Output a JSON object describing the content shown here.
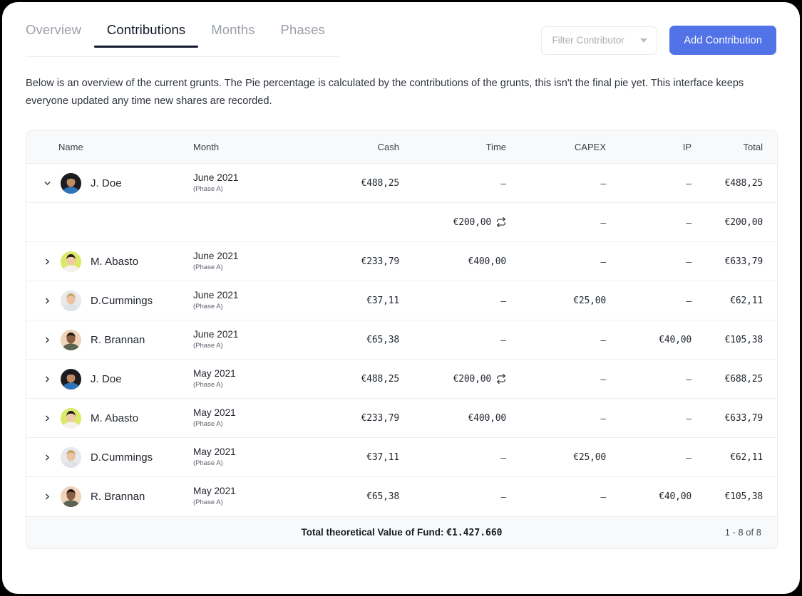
{
  "tabs": [
    {
      "label": "Overview",
      "active": false
    },
    {
      "label": "Contributions",
      "active": true
    },
    {
      "label": "Months",
      "active": false
    },
    {
      "label": "Phases",
      "active": false
    }
  ],
  "toolbar": {
    "filter_placeholder": "Filter Contributor",
    "add_button_label": "Add Contribution"
  },
  "description": "Below is an overview of the current grunts. The Pie percentage is calculated by the contributions of the grunts, this isn't the final pie yet. This interface keeps everyone updated any time new shares are recorded.",
  "table": {
    "columns": [
      "Name",
      "Month",
      "Cash",
      "Time",
      "CAPEX",
      "IP",
      "Total"
    ],
    "rows": [
      {
        "expanded": true,
        "sub": false,
        "name": "J. Doe",
        "avatar": "avatar-jdoe",
        "month": "June 2021",
        "phase": "(Phase A)",
        "cash": "€488,25",
        "time": "–",
        "time_recurring": false,
        "capex": "–",
        "ip": "–",
        "total": "€488,25"
      },
      {
        "expanded": false,
        "sub": true,
        "name": "",
        "avatar": "",
        "month": "",
        "phase": "",
        "cash": "",
        "time": "€200,00",
        "time_recurring": true,
        "capex": "–",
        "ip": "–",
        "total": "€200,00"
      },
      {
        "expanded": false,
        "sub": false,
        "name": "M. Abasto",
        "avatar": "avatar-mabasto",
        "month": "June 2021",
        "phase": "(Phase A)",
        "cash": "€233,79",
        "time": "€400,00",
        "time_recurring": false,
        "capex": "–",
        "ip": "–",
        "total": "€633,79"
      },
      {
        "expanded": false,
        "sub": false,
        "name": "D.Cummings",
        "avatar": "avatar-dcummings",
        "month": "June 2021",
        "phase": "(Phase A)",
        "cash": "€37,11",
        "time": "–",
        "time_recurring": false,
        "capex": "€25,00",
        "ip": "–",
        "total": "€62,11"
      },
      {
        "expanded": false,
        "sub": false,
        "name": "R. Brannan",
        "avatar": "avatar-rbrannan",
        "month": "June 2021",
        "phase": "(Phase A)",
        "cash": "€65,38",
        "time": "–",
        "time_recurring": false,
        "capex": "–",
        "ip": "€40,00",
        "total": "€105,38"
      },
      {
        "expanded": false,
        "sub": false,
        "name": "J. Doe",
        "avatar": "avatar-jdoe",
        "month": "May 2021",
        "phase": "(Phase A)",
        "cash": "€488,25",
        "time": "€200,00",
        "time_recurring": true,
        "capex": "–",
        "ip": "–",
        "total": "€688,25"
      },
      {
        "expanded": false,
        "sub": false,
        "name": "M. Abasto",
        "avatar": "avatar-mabasto",
        "month": "May 2021",
        "phase": "(Phase A)",
        "cash": "€233,79",
        "time": "€400,00",
        "time_recurring": false,
        "capex": "–",
        "ip": "–",
        "total": "€633,79"
      },
      {
        "expanded": false,
        "sub": false,
        "name": "D.Cummings",
        "avatar": "avatar-dcummings",
        "month": "May 2021",
        "phase": "(Phase A)",
        "cash": "€37,11",
        "time": "–",
        "time_recurring": false,
        "capex": "€25,00",
        "ip": "–",
        "total": "€62,11"
      },
      {
        "expanded": false,
        "sub": false,
        "name": "R. Brannan",
        "avatar": "avatar-rbrannan",
        "month": "May 2021",
        "phase": "(Phase A)",
        "cash": "€65,38",
        "time": "–",
        "time_recurring": false,
        "capex": "–",
        "ip": "€40,00",
        "total": "€105,38"
      }
    ],
    "footer": {
      "total_label": "Total theoretical Value of Fund: ",
      "total_value": "€1.427.660",
      "pagination": "1 - 8 of 8"
    }
  },
  "colors": {
    "accent": "#5272e8",
    "text_primary": "#1f242c",
    "text_muted": "#9ca0a8",
    "header_bg": "#f8f9fa",
    "border": "#ececee"
  }
}
